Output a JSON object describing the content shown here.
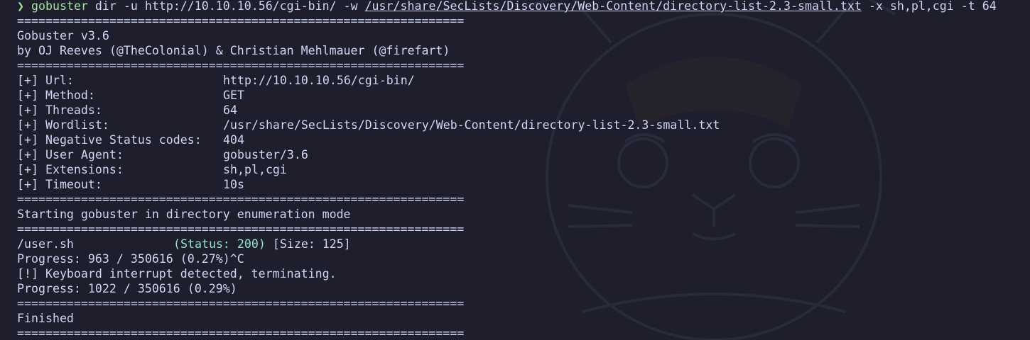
{
  "command": {
    "prompt_symbol": "❯",
    "program": "gobuster",
    "args_before_path": " dir -u http://10.10.10.56/cgi-bin/ -w ",
    "wordlist_path": "/usr/share/SecLists/Discovery/Web-Content/directory-list-2.3-small.txt",
    "args_after_path": " -x sh,pl,cgi -t 64"
  },
  "separator": "===============================================================",
  "banner": {
    "name": "Gobuster v3.6",
    "authors": "by OJ Reeves (@TheColonial) & Christian Mehlmauer (@firefart)"
  },
  "config": [
    {
      "key": "[+] Url:",
      "value": "http://10.10.10.56/cgi-bin/"
    },
    {
      "key": "[+] Method:",
      "value": "GET"
    },
    {
      "key": "[+] Threads:",
      "value": "64"
    },
    {
      "key": "[+] Wordlist:",
      "value": "/usr/share/SecLists/Discovery/Web-Content/directory-list-2.3-small.txt"
    },
    {
      "key": "[+] Negative Status codes:",
      "value": "404"
    },
    {
      "key": "[+] User Agent:",
      "value": "gobuster/3.6"
    },
    {
      "key": "[+] Extensions:",
      "value": "sh,pl,cgi"
    },
    {
      "key": "[+] Timeout:",
      "value": "10s"
    }
  ],
  "mode_line": "Starting gobuster in directory enumeration mode",
  "result": {
    "path": "/user.sh",
    "status": "(Status: 200)",
    "size": "[Size: 125]"
  },
  "progress_1": "Progress: 963 / 350616 (0.27%)^C",
  "interrupt": "[!] Keyboard interrupt detected, terminating.",
  "progress_2": "Progress: 1022 / 350616 (0.29%)",
  "finished": "Finished",
  "colors": {
    "background": "#1e1e2c",
    "text": "#cdd6f4",
    "prompt_green": "#a6e3a1",
    "status_teal": "#94e2d5"
  }
}
